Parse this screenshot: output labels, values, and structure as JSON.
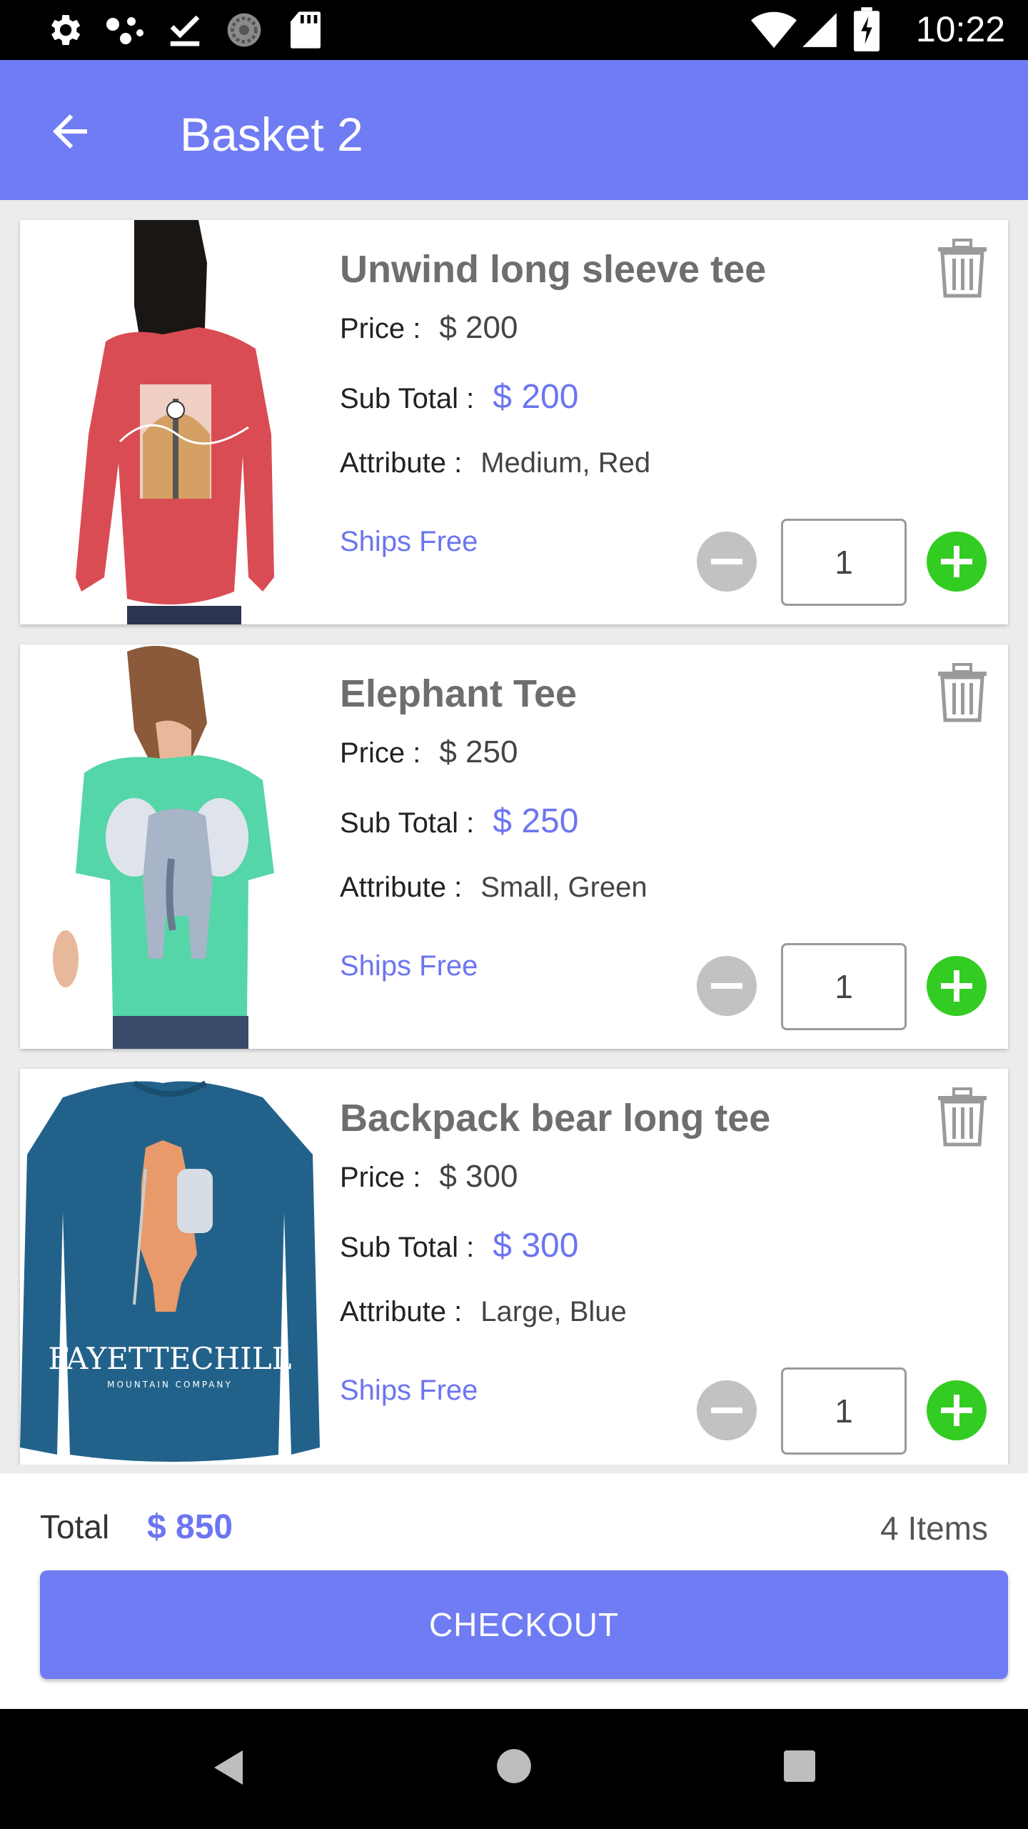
{
  "status_bar": {
    "time": "10:22",
    "icons": [
      "settings-icon",
      "dots-icon",
      "check-download-icon",
      "sync-icon",
      "sd-card-icon",
      "wifi-icon",
      "signal-icon",
      "battery-charging-icon"
    ]
  },
  "app_bar": {
    "title": "Basket 2",
    "back_icon": "arrow-back-icon"
  },
  "items": [
    {
      "name": "Unwind long sleeve tee",
      "price_label": "Price :",
      "price": "$ 200",
      "subtotal_label": "Sub Total :",
      "subtotal": "$ 200",
      "attribute_label": "Attribute :",
      "attribute": "Medium, Red",
      "shipping": "Ships Free",
      "quantity": "1"
    },
    {
      "name": "Elephant Tee",
      "price_label": "Price :",
      "price": "$ 250",
      "subtotal_label": "Sub Total :",
      "subtotal": "$ 250",
      "attribute_label": "Attribute :",
      "attribute": "Small, Green",
      "shipping": "Ships Free",
      "quantity": "1"
    },
    {
      "name": "Backpack bear long tee",
      "price_label": "Price :",
      "price": "$ 300",
      "subtotal_label": "Sub Total :",
      "subtotal": "$ 300",
      "attribute_label": "Attribute :",
      "attribute": "Large, Blue",
      "shipping": "Ships Free",
      "quantity": "1",
      "image_text": "FAYETTECHILL",
      "image_subtext": "MOUNTAIN COMPANY"
    }
  ],
  "footer": {
    "total_label": "Total",
    "total_value": "$ 850",
    "items_count": "4 Items",
    "checkout_label": "CHECKOUT"
  },
  "colors": {
    "primary": "#707cf3",
    "accent_text": "#6c75f0",
    "plus_green": "#33cc22",
    "minus_gray": "#c2c2c2"
  },
  "nav_bar": {
    "icons": [
      "back-triangle-icon",
      "home-circle-icon",
      "recents-square-icon"
    ]
  }
}
